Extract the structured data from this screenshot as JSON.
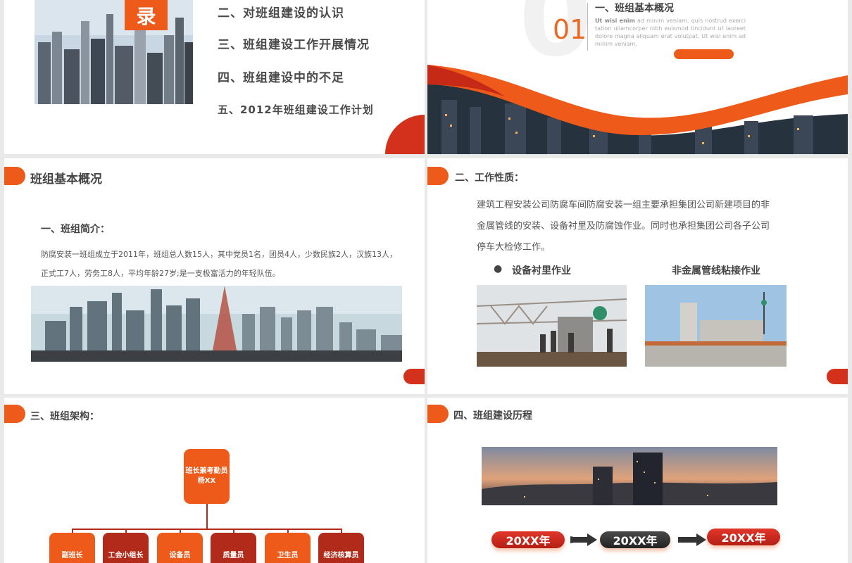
{
  "toc": {
    "badge": "录",
    "items": [
      "二、对班组建设的认识",
      "三、班组建设工作开展情况",
      "四、班组建设中的不足",
      "五、2012年班组建设工作计划"
    ]
  },
  "chapter": {
    "number": "01",
    "title": "一、班组基本概况",
    "lorem_bold": "Ut wisi enim",
    "lorem": " ad minim veniam, quis nostrud exerci tation ullamcorper nibh euismod tincidunt ut laoreet dolore magna aliquam erat volutpat. Ut wisi enim ad minim veniam,"
  },
  "overview": {
    "title": "班组基本概况",
    "subtitle": "一、班组简介：",
    "line1": "防腐安装一班组成立于2011年，班组总人数15人，其中党员1名，团员4人，少数民族2人，汉族13人，",
    "line2": "正式工7人，劳务工8人，平均年龄27岁;是一支极富活力的年轻队伍。"
  },
  "work": {
    "title": "二、工作性质：",
    "line1": "建筑工程安装公司防腐车间防腐安装一组主要承担集团公司新建项目的非",
    "line2": "金属管线的安装、设备衬里及防腐蚀作业。同时也承担集团公司各子公司",
    "line3": "停车大检修工作。",
    "item1": "设备衬里作业",
    "item2": "非金属管线粘接作业",
    "bullet": "●"
  },
  "org": {
    "title": "三、班组架构：",
    "top_line1": "班长兼考勤员",
    "top_line2": "杨XX",
    "members": [
      {
        "label": "副班长",
        "color": "#ee5a1a"
      },
      {
        "label": "工会小组长",
        "color": "#b22a1a"
      },
      {
        "label": "设备员",
        "color": "#ee5a1a"
      },
      {
        "label": "质量员",
        "color": "#b22a1a"
      },
      {
        "label": "卫生员",
        "color": "#ee5a1a"
      },
      {
        "label": "经济核算员",
        "color": "#b22a1a"
      }
    ]
  },
  "history": {
    "title": "四、班组建设历程",
    "years": [
      "20XX年",
      "20XX年",
      "20XX年"
    ]
  },
  "colors": {
    "accent": "#ee5a1a",
    "dark_red": "#b22a1a",
    "red": "#d3311c"
  }
}
